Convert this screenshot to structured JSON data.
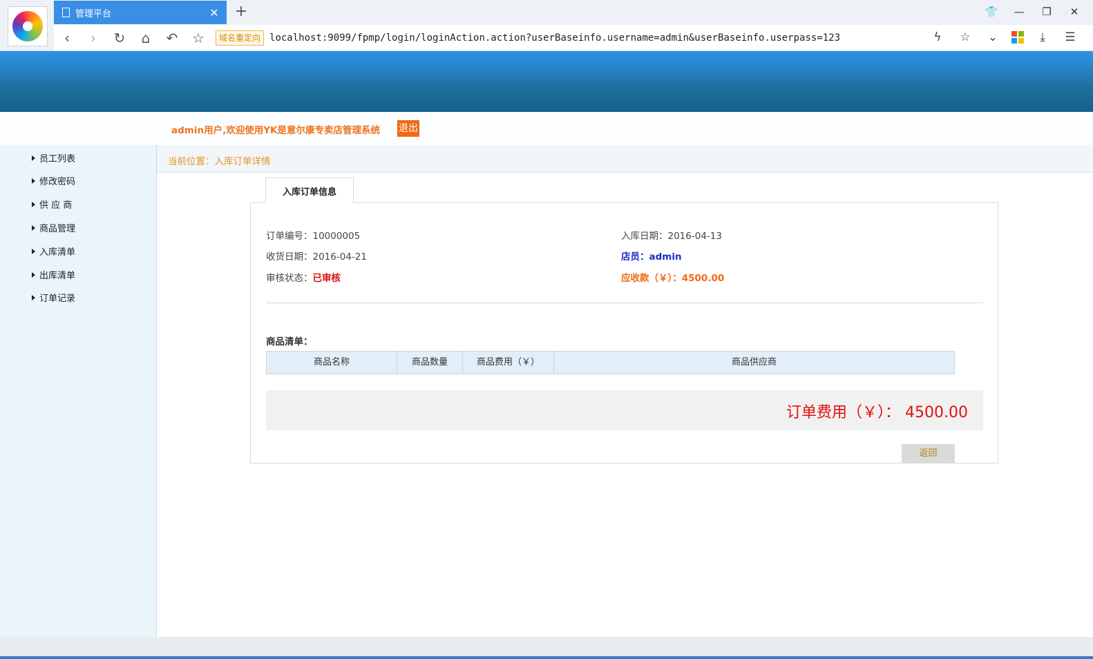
{
  "browser": {
    "tab_title": "管理平台",
    "tab_close": "✕",
    "new_tab": "+",
    "redirect_badge": "域名重定向",
    "url": "localhost:9099/fpmp/login/loginAction.action?userBaseinfo.username=admin&userBaseinfo.userpass=123",
    "icons": [
      "back-icon",
      "forward-icon",
      "reload-icon",
      "home-icon",
      "undo-icon",
      "star-icon"
    ]
  },
  "header": {
    "welcome": "admin用户,欢迎使用YK是意尔康专卖店管理系统",
    "logout": "退出"
  },
  "sidebar": {
    "items": [
      {
        "label": "员工列表"
      },
      {
        "label": "修改密码"
      },
      {
        "label": "供 应 商"
      },
      {
        "label": "商品管理"
      },
      {
        "label": "入库清单"
      },
      {
        "label": "出库清单"
      },
      {
        "label": "订单记录"
      }
    ]
  },
  "breadcrumb": "当前位置：入库订单详情",
  "panel": {
    "tab_label": "入库订单信息",
    "order_no_label": "订单编号：",
    "order_no": "10000005",
    "receive_date_label": "收货日期：",
    "receive_date": "2016-04-21",
    "audit_label": "审核状态：",
    "audit_status": "已审核",
    "stock_date_label": "入库日期：",
    "stock_date": "2016-04-13",
    "clerk_label": "店员：",
    "clerk": "admin",
    "receivable_label": "应收款（￥）：",
    "receivable": "4500.00",
    "list_title": "商品清单：",
    "columns": [
      "商品名称",
      "商品数量",
      "商品费用（￥）",
      "商品供应商"
    ],
    "total_label": "订单费用（￥）：",
    "total": "4500.00",
    "back_button": "返回"
  },
  "colors": {
    "banner": "#1e6f9f",
    "accent_orange": "#f06a12",
    "status_red": "#e01010",
    "clerk_blue": "#1a2dcf"
  }
}
